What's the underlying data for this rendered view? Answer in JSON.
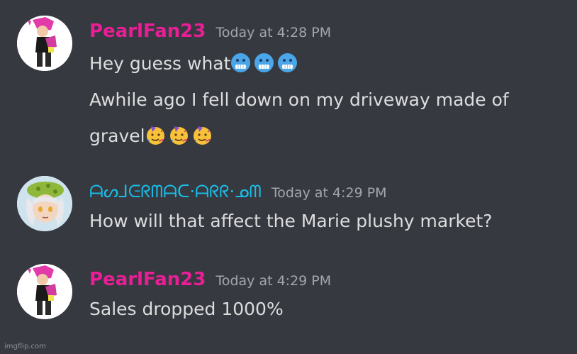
{
  "colors": {
    "background": "#36393f",
    "message_text": "#dcddde",
    "timestamp": "#a3a6aa",
    "pearlfan_name": "#e91e96",
    "asier_name": "#1abce8"
  },
  "messages": [
    {
      "avatar": "pearl-avatar",
      "username": "PearlFan23",
      "timestamp": "Today at 4:28 PM",
      "lines": [
        {
          "text": "Hey guess what",
          "emojis": [
            "cold-face-emoji",
            "cold-face-emoji",
            "cold-face-emoji"
          ]
        },
        {
          "text": "Awhile ago I fell down on my driveway made of",
          "emojis": []
        },
        {
          "text": "gravel",
          "emojis": [
            "partying-face-emoji",
            "partying-face-emoji",
            "partying-face-emoji"
          ]
        }
      ]
    },
    {
      "avatar": "marie-avatar",
      "username": "ᗩᔕ⅃ᕮᖇᗰᗩᑕ·ᗩᖇᖇ·ᓄᗰ",
      "timestamp": "Today at 4:29 PM",
      "lines": [
        {
          "text": "How will that affect the Marie plushy market?",
          "emojis": []
        }
      ]
    },
    {
      "avatar": "pearl-avatar",
      "username": "PearlFan23",
      "timestamp": "Today at 4:29 PM",
      "lines": [
        {
          "text": "Sales dropped 1000%",
          "emojis": []
        }
      ]
    }
  ],
  "watermark": "imgflip.com"
}
